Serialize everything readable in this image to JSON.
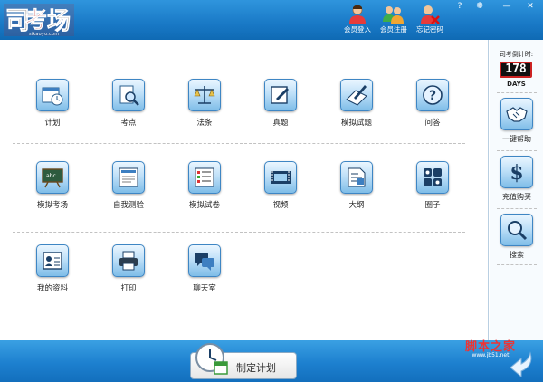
{
  "app": {
    "logo_url": "sikaoyo.com"
  },
  "header": {
    "buttons": [
      {
        "label": "会员登入",
        "icon": "user-login-icon"
      },
      {
        "label": "会员注册",
        "icon": "user-register-icon"
      },
      {
        "label": "忘记密码",
        "icon": "forgot-password-icon"
      }
    ],
    "window_controls": [
      "?",
      "❁",
      "—",
      "✕"
    ]
  },
  "tiles": [
    {
      "label": "计划",
      "icon": "calendar-clock-icon"
    },
    {
      "label": "考点",
      "icon": "magnifier-document-icon"
    },
    {
      "label": "法条",
      "icon": "scales-icon"
    },
    {
      "label": "真题",
      "icon": "edit-note-icon"
    },
    {
      "label": "模拟试题",
      "icon": "pen-paper-icon"
    },
    {
      "label": "问答",
      "icon": "question-icon"
    },
    {
      "label": "模拟考场",
      "icon": "blackboard-icon"
    },
    {
      "label": "自我测验",
      "icon": "test-paper-icon"
    },
    {
      "label": "模拟试卷",
      "icon": "checklist-icon"
    },
    {
      "label": "视频",
      "icon": "film-icon"
    },
    {
      "label": "大纲",
      "icon": "outline-document-icon"
    },
    {
      "label": "圈子",
      "icon": "grid-circle-icon"
    },
    {
      "label": "我的资料",
      "icon": "profile-card-icon"
    },
    {
      "label": "打印",
      "icon": "printer-icon"
    },
    {
      "label": "聊天室",
      "icon": "chat-icon"
    }
  ],
  "sidebar": {
    "countdown_title": "司考倒计时:",
    "countdown_value": "178",
    "countdown_unit": "DAYS",
    "buttons": [
      {
        "label": "一键帮助",
        "icon": "handshake-icon"
      },
      {
        "label": "充值购买",
        "icon": "dollar-icon"
      },
      {
        "label": "搜索",
        "icon": "search-icon"
      }
    ]
  },
  "footer": {
    "plan_button": "制定计划"
  },
  "watermark": {
    "main": "脚本之家",
    "url": "www.jb51.net"
  },
  "colors": {
    "header_blue": "#1979c6",
    "footer_blue": "#1d80cf",
    "tile_border": "#3e86c4",
    "watermark_red": "#e33333"
  }
}
